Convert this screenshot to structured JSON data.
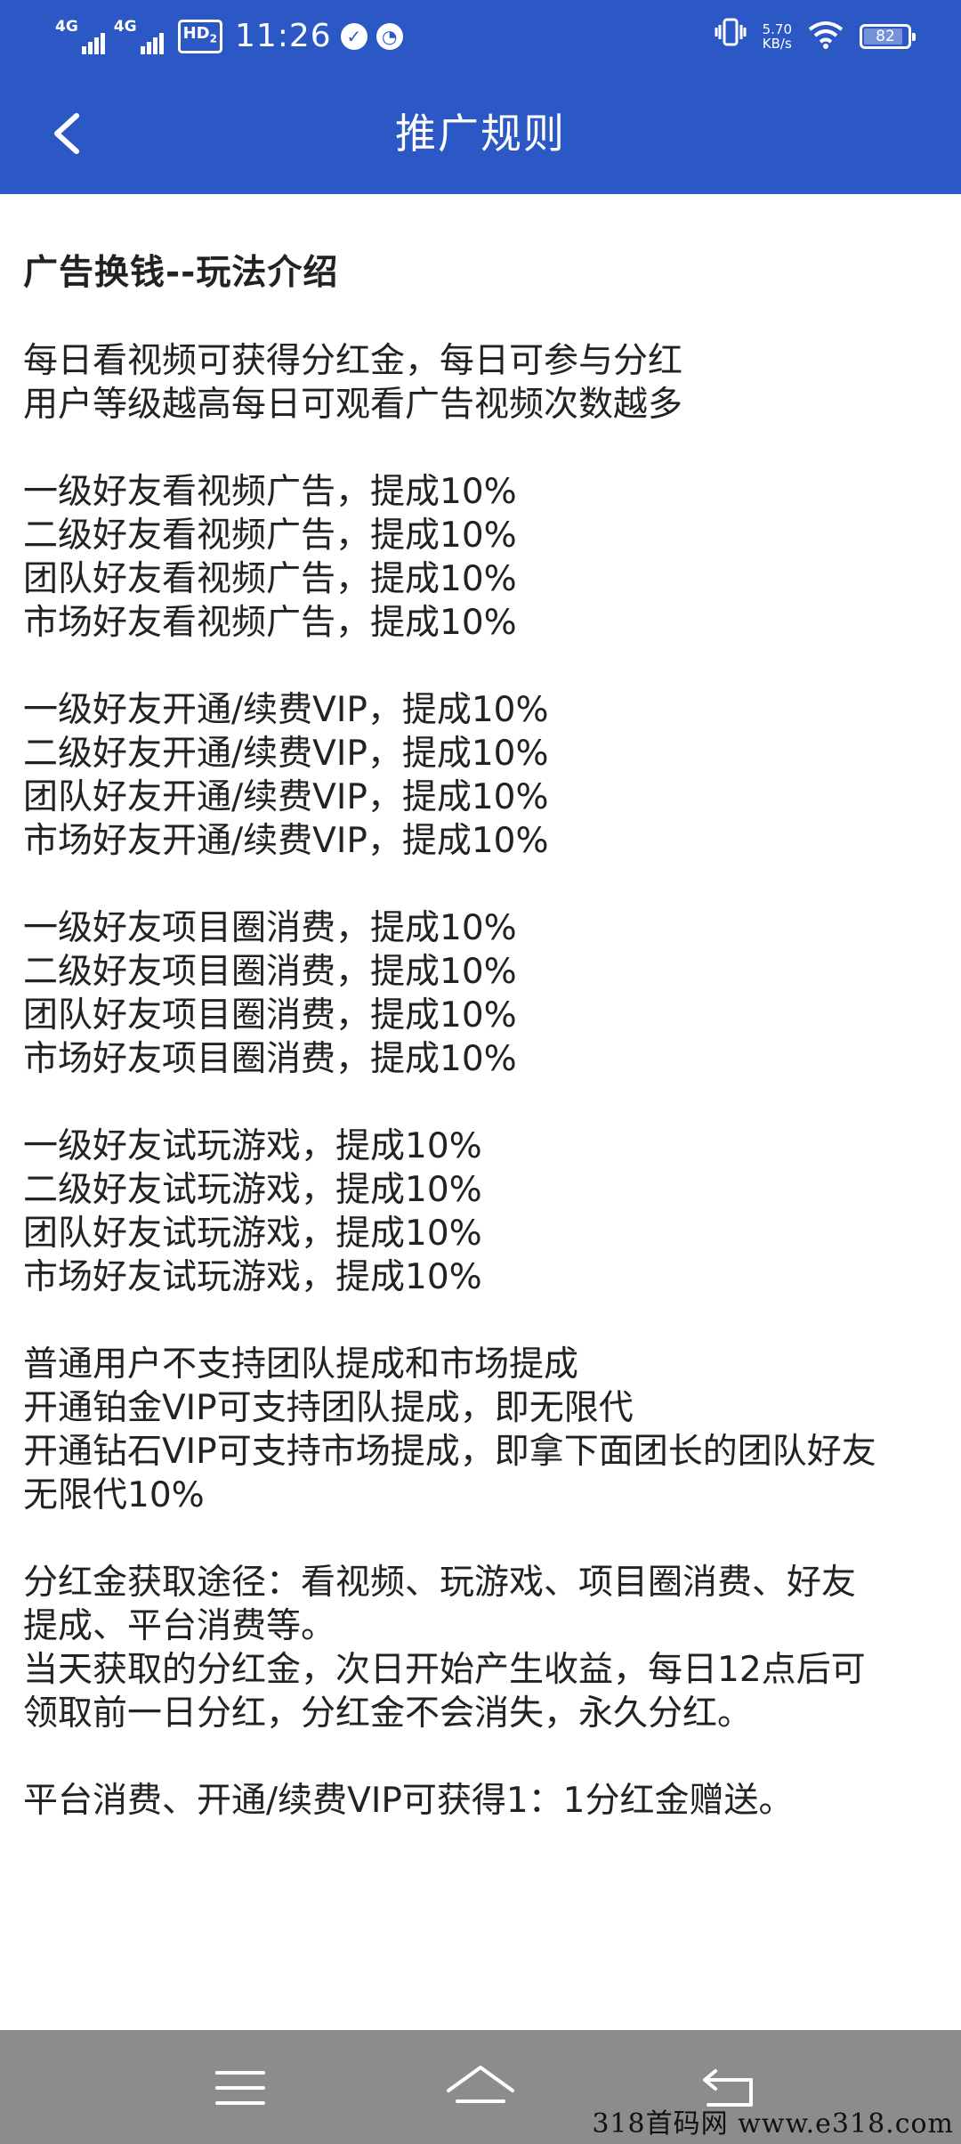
{
  "status_bar": {
    "network1": "4G",
    "network2": "4G",
    "hd": "HD",
    "hd_sub": "2",
    "time": "11:26",
    "speed_value": "5.70",
    "speed_unit": "KB/s",
    "battery": "82",
    "battery_fraction": 0.82
  },
  "header": {
    "title": "推广规则"
  },
  "content": {
    "heading": "广告换钱--玩法介绍",
    "paragraphs": [
      [
        "每日看视频可获得分红金，每日可参与分红",
        "用户等级越高每日可观看广告视频次数越多"
      ],
      [
        "一级好友看视频广告，提成10%",
        "二级好友看视频广告，提成10%",
        "团队好友看视频广告，提成10%",
        "市场好友看视频广告，提成10%"
      ],
      [
        "一级好友开通/续费VIP，提成10%",
        "二级好友开通/续费VIP，提成10%",
        "团队好友开通/续费VIP，提成10%",
        "市场好友开通/续费VIP，提成10%"
      ],
      [
        "一级好友项目圈消费，提成10%",
        "二级好友项目圈消费，提成10%",
        "团队好友项目圈消费，提成10%",
        "市场好友项目圈消费，提成10%"
      ],
      [
        "一级好友试玩游戏，提成10%",
        "二级好友试玩游戏，提成10%",
        "团队好友试玩游戏，提成10%",
        "市场好友试玩游戏，提成10%"
      ],
      [
        "普通用户不支持团队提成和市场提成",
        "开通铂金VIP可支持团队提成，即无限代",
        "开通钻石VIP可支持市场提成，即拿下面团长的团队好友",
        "无限代10%"
      ],
      [
        "分红金获取途径：看视频、玩游戏、项目圈消费、好友",
        "提成、平台消费等。",
        "当天获取的分红金，次日开始产生收益，每日12点后可",
        "领取前一日分红，分红金不会消失，永久分红。"
      ],
      [
        "平台消费、开通/续费VIP可获得1：1分红金赠送。"
      ]
    ]
  },
  "watermark": "318首码网  www.e318.com",
  "colors": {
    "header_bg": "#2c58c5",
    "nav_bg": "#8c8c8c",
    "text": "#222222"
  },
  "icons": {
    "back": "chevron-left-icon",
    "menu": "menu-icon",
    "home": "home-icon",
    "return": "return-icon"
  }
}
